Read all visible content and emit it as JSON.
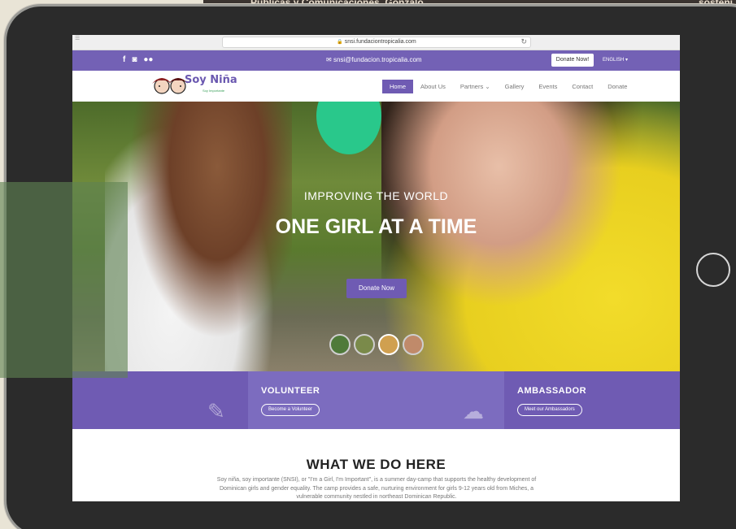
{
  "background": {
    "strip_text_left": "Publicas y Comunicaciones, Gonzalo",
    "strip_text_right": "sosteni"
  },
  "browser": {
    "url": "snsi.fundaciontropicalia.com"
  },
  "topbar": {
    "social_icons": [
      "facebook-icon",
      "instagram-icon",
      "flickr-icon"
    ],
    "email": "snsi@fundacion.tropicalia.com",
    "donate_label": "Donate Now!",
    "language": "ENGLISH"
  },
  "navbar": {
    "logo_text": "Soy Niña",
    "logo_subtext": "Soy Importante",
    "items": [
      {
        "label": "Home"
      },
      {
        "label": "About Us"
      },
      {
        "label": "Partners"
      },
      {
        "label": "Gallery"
      },
      {
        "label": "Events"
      },
      {
        "label": "Contact"
      },
      {
        "label": "Donate"
      }
    ],
    "active_index": 0
  },
  "hero": {
    "subtitle": "IMPROVING THE WORLD",
    "title": "ONE GIRL AT A TIME",
    "button_label": "Donate Now"
  },
  "cta": {
    "volunteer_title": "VOLUNTEER",
    "volunteer_button": "Become a Volunteer",
    "ambassador_title": "AMBASSADOR",
    "ambassador_button": "Meet our Ambassadors"
  },
  "what": {
    "title": "WHAT WE DO HERE",
    "body": "Soy niña, soy importante (SNSI), or \"I'm a Girl, I'm Important\", is a summer day-camp that supports the healthy development of Dominican girls and gender equality. The camp provides a safe, nurturing environment for girls 9-12 years old from Miches, a vulnerable community nestled in northeast Dominican Republic."
  },
  "colors": {
    "brand_purple": "#7361b5",
    "button_purple": "#6f5bb3",
    "tablet_frame": "#2b2b2b"
  }
}
